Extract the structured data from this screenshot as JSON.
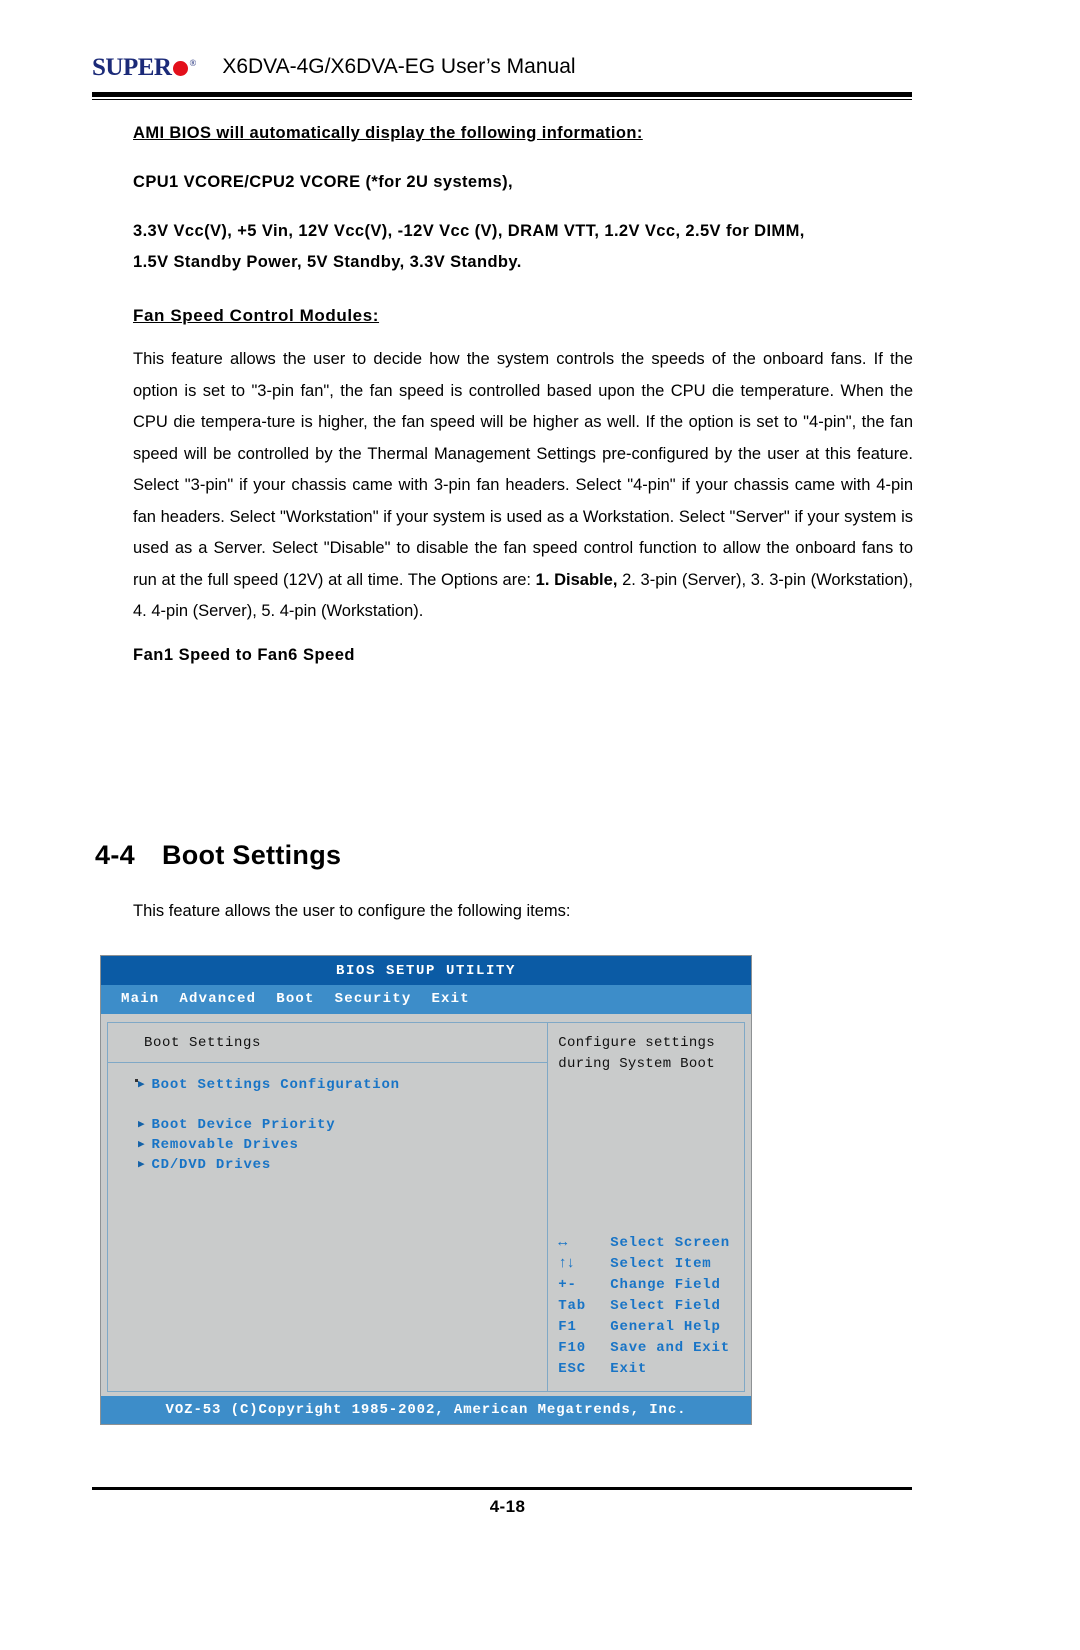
{
  "header": {
    "logo_text": "SUPER",
    "logo_reg": "®",
    "doc_title": "X6DVA-4G/X6DVA-EG User’s Manual"
  },
  "body": {
    "ami_line": "AMI BIOS will automatically display the following information:",
    "vcore_line": "CPU1 VCORE/CPU2 VCORE (*for 2U systems),",
    "voltage_line_1": "3.3V Vcc(V), +5 Vin, 12V Vcc(V), -12V Vcc (V), DRAM VTT, 1.2V Vcc, 2.5V for DIMM,",
    "voltage_line_2": "1.5V Standby Power, 5V Standby, 3.3V Standby.",
    "fan_heading": "Fan Speed Control Modules:",
    "fan_para_part1": "This feature allows the user to decide how the system controls the speeds of the onboard fans. If the option is set to \"3-pin fan\", the fan speed is controlled based upon the CPU die temperature. When the CPU die tempera-ture is higher, the fan speed will be higher as well. If the option is set to \"4-pin\", the fan speed will be controlled by the Thermal Management Settings pre-configured by the user at this feature. Select \"3-pin\" if your chassis came with 3-pin fan headers. Select \"4-pin\" if your chassis came with 4-pin fan headers.   Select \"Workstation\" if your system is used as a Workstation. Select \"Server\" if your system  is used as a Server. Select \"Disable\" to disable  the fan speed control function to allow the onboard fans to run at the full speed (12V) at all time.  The Options are: ",
    "fan_para_bold": "1. Disable,",
    "fan_para_part2": " 2. 3-pin (Server), 3. 3-pin (Workstation),  4. 4-pin (Server), 5. 4-pin (Workstation).",
    "fan_speed_line": "Fan1 Speed to Fan6 Speed"
  },
  "section": {
    "number": "4-4",
    "title": "Boot Settings",
    "intro": "This feature allows the user to  configure the  following items:"
  },
  "bios": {
    "title": "BIOS SETUP UTILITY",
    "menu": [
      "Main",
      "Advanced",
      "Boot",
      "Security",
      "Exit"
    ],
    "panel_header": "Boot Settings",
    "items": [
      "Boot Settings Configuration",
      "Boot Device Priority",
      "Removable Drives",
      "CD/DVD Drives"
    ],
    "help_line_1": "Configure settings",
    "help_line_2": "during System Boot",
    "keys": [
      {
        "key": "↔",
        "desc": "Select Screen",
        "arrow": true
      },
      {
        "key": "↑↓",
        "desc": "Select Item",
        "arrow": true
      },
      {
        "key": "+-",
        "desc": "Change Field",
        "arrow": false
      },
      {
        "key": "Tab",
        "desc": "Select Field",
        "arrow": false
      },
      {
        "key": "F1",
        "desc": "General Help",
        "arrow": false
      },
      {
        "key": "F10",
        "desc": "Save and Exit",
        "arrow": false
      },
      {
        "key": "ESC",
        "desc": "Exit",
        "arrow": false
      }
    ],
    "footer": "VOZ-53 (C)Copyright 1985-2002, American Megatrends, Inc.",
    "colors": {
      "title_bar": "#0b5ba5",
      "menu_bar": "#3d8dc9",
      "panel_bg": "#c9cbcb",
      "link_blue": "#1874c6"
    }
  },
  "footer": {
    "page_number": "4-18"
  }
}
